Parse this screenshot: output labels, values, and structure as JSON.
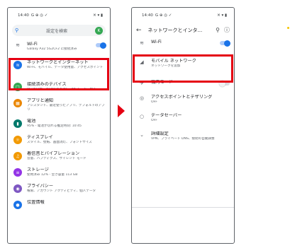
{
  "status_bar": {
    "time": "14:40",
    "left_glyphs": "G ⊕ ◎ ✓",
    "right_glyphs": "✕ ▾ ▮"
  },
  "settings": {
    "search_placeholder": "設定を検索",
    "avatar_letter": "K",
    "items": [
      {
        "title": "Wi-Fi",
        "subtitle": "Galaxy A32 5G2CF2 に接続済み",
        "icon": "wifi-icon"
      },
      {
        "title": "ネットワークとインターネット",
        "subtitle": "Wi-Fi、モバイル、データ使用量、アクセスポイント",
        "icon": "wifi-icon"
      },
      {
        "title": "接続済みのデバイス",
        "subtitle": "Bluetooth、Android Auto、運転モード、NFC",
        "icon": "devices-icon"
      },
      {
        "title": "アプリと通知",
        "subtitle": "アシスタント、最近使ったアプリ、デフォルトのアプリ",
        "icon": "apps-icon"
      },
      {
        "title": "電池",
        "subtitle": "95% - 電池が切れる推定時刻: 10:45",
        "icon": "battery-icon"
      },
      {
        "title": "ディスプレイ",
        "subtitle": "スタイル、壁紙、画面消灯、フォントサイズ",
        "icon": "display-icon"
      },
      {
        "title": "着信音とバイブレーション",
        "subtitle": "音量、ハプティクス、サイレント モード",
        "icon": "sound-icon"
      },
      {
        "title": "ストレージ",
        "subtitle": "使用済み 12% - 空き容量 113 GB",
        "icon": "storage-icon"
      },
      {
        "title": "プライバシー",
        "subtitle": "権限、アカウント アクティビティ、個人データ",
        "icon": "privacy-icon"
      },
      {
        "title": "位置情報",
        "subtitle": "",
        "icon": "location-icon"
      }
    ]
  },
  "network": {
    "title": "ネットワークとインタ...",
    "items": [
      {
        "title": "Wi-Fi",
        "subtitle": ""
      },
      {
        "title": "モバイル ネットワーク",
        "subtitle": "ネットワークを追加"
      },
      {
        "title": "機内モード",
        "subtitle": ""
      },
      {
        "title": "アクセスポイントとテザリング",
        "subtitle": "OFF"
      },
      {
        "title": "データセーバー",
        "subtitle": "OFF"
      },
      {
        "title": "詳細設定",
        "subtitle": "VPN、プライベート DNS、接続の自動調整"
      }
    ]
  },
  "colors": {
    "highlight": "#e50012",
    "accent": "#1a73e8",
    "icon_network": "#1a73e8",
    "icon_devices": "#34a853",
    "icon_apps": "#ea8600",
    "icon_battery": "#00796b",
    "icon_display": "#f29900",
    "icon_sound": "#f29900",
    "icon_storage": "#9334e6",
    "icon_privacy": "#7e57c2",
    "icon_location": "#1a73e8"
  }
}
